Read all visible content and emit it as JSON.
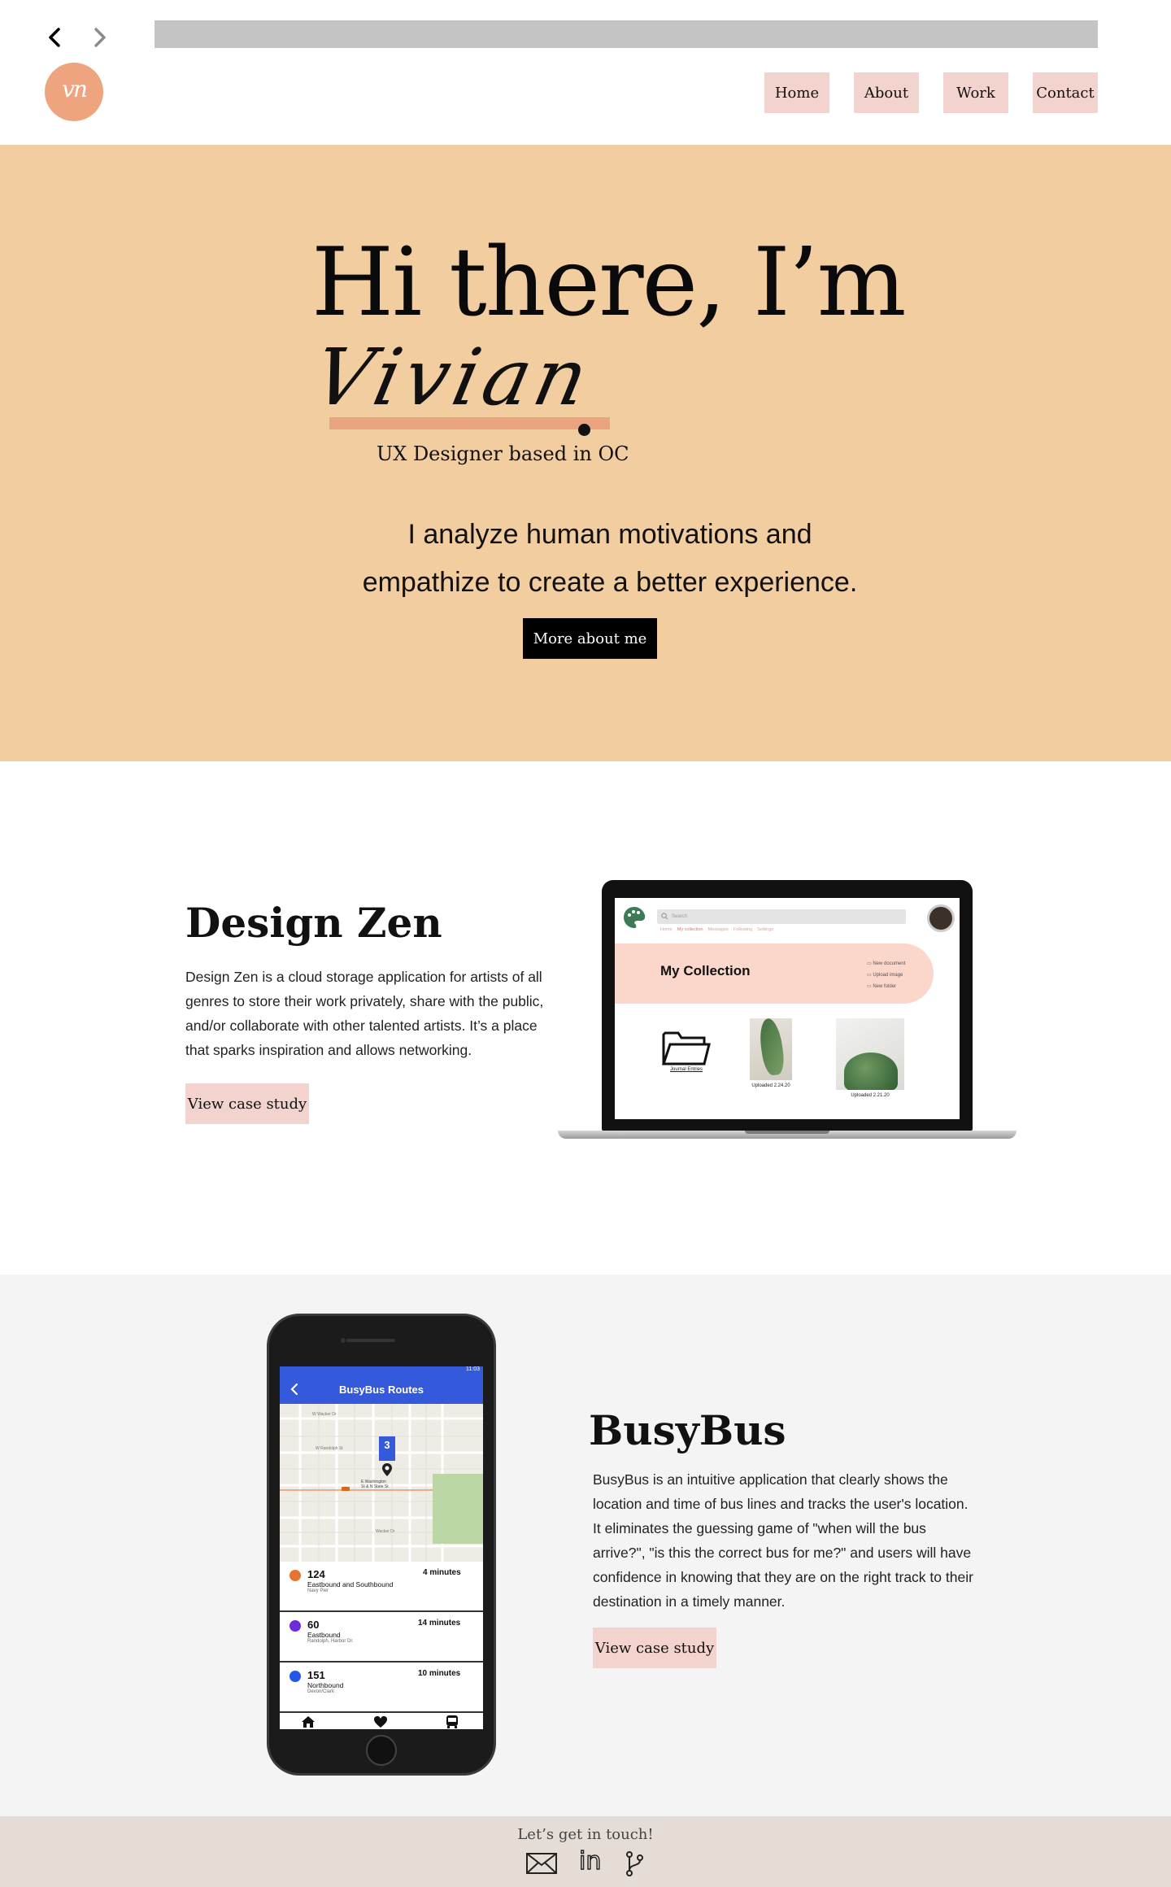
{
  "nav": {
    "back_icon": "chevron-left-icon",
    "forward_icon": "chevron-right-icon",
    "logo_text": "vn",
    "items": [
      {
        "label": "Home"
      },
      {
        "label": "About"
      },
      {
        "label": "Work"
      },
      {
        "label": "Contact"
      }
    ]
  },
  "hero": {
    "greeting": "Hi there, I’m",
    "name": "Vivian",
    "subtitle": "UX Designer based in OC",
    "tagline": "I analyze human motivations and empathize to create a better experience.",
    "cta_label": "More about me"
  },
  "projects": [
    {
      "title": "Design Zen",
      "description": "Design Zen is a cloud storage application for artists of all genres to store their work privately, share with the public, and/or collaborate with other talented artists. It’s a place that sparks inspiration and allows networking.",
      "cta_label": "View case study",
      "mockup": {
        "search_placeholder": "Search",
        "tabs": [
          "Home",
          "My collection",
          "Messages",
          "Following",
          "Settings"
        ],
        "heading": "My Collection",
        "actions": [
          "New document",
          "Upload image",
          "New folder"
        ],
        "items": [
          {
            "caption": "Journal Entries"
          },
          {
            "caption": "Uploaded 2.24.20"
          },
          {
            "caption": "Uploaded 2.21.20"
          }
        ]
      }
    },
    {
      "title": "BusyBus",
      "description": "BusyBus is an intuitive application that clearly shows the location and time of bus lines and tracks the user's location. It eliminates the guessing game of \"when will the bus arrive?\", \"is this the correct bus for me?\" and users will have confidence in knowing that they are on the right track to their destination in a timely manner.",
      "cta_label": "View case study",
      "mockup": {
        "status_time": "11:03",
        "header": "BusyBus Routes",
        "map_marker": "3",
        "map_streets": [
          "W Wacker Dr",
          "W Randolph St",
          "E Washington",
          "St & N State St",
          "Wacker Dr"
        ],
        "routes": [
          {
            "number": "124",
            "time": "4 minutes",
            "direction": "Eastbound and Southbound",
            "stop": "Navy Pier",
            "color": "#e8732f"
          },
          {
            "number": "60",
            "time": "14 minutes",
            "direction": "Eastbound",
            "stop": "Randolph, Harbor Dr.",
            "color": "#6d2bdc"
          },
          {
            "number": "151",
            "time": "10 minutes",
            "direction": "Northbound",
            "stop": "Devon/Clark",
            "color": "#2457e6"
          }
        ],
        "tabbar_icons": [
          "home-icon",
          "heart-icon",
          "bus-icon"
        ]
      }
    }
  ],
  "footer": {
    "text": "Let’s get in touch!",
    "icons": [
      "mail-icon",
      "linkedin-icon",
      "git-branch-icon"
    ],
    "linkedin_text": "in"
  },
  "colors": {
    "hero_bg": "#f2cda0",
    "accent": "#eda47f",
    "button_pink": "#f2d3cd",
    "footer_bg": "#e5ddd5",
    "section_gray": "#f4f4f4",
    "app_blue": "#3559db"
  }
}
